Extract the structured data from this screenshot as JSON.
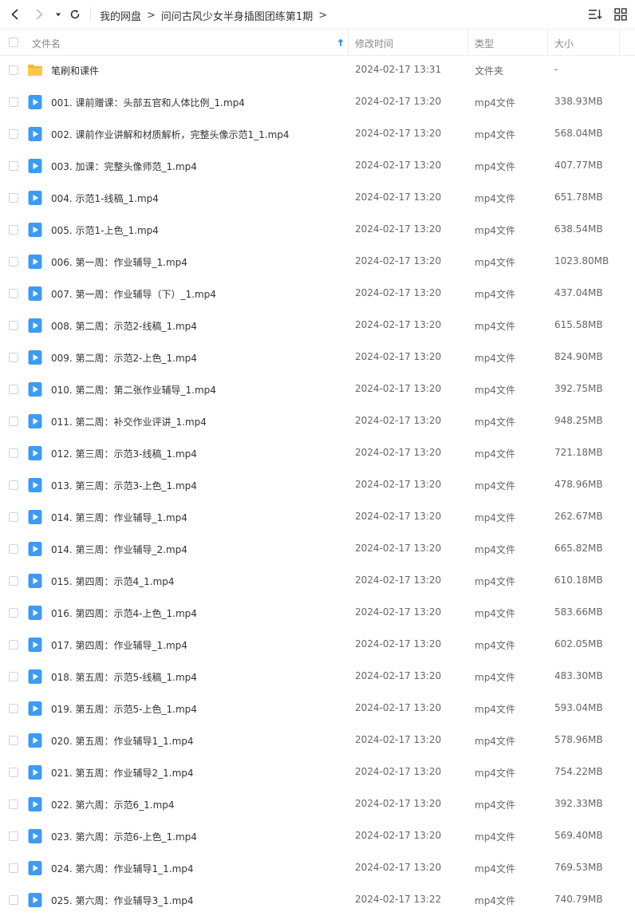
{
  "breadcrumb": [
    "我的网盘",
    "问问古风少女半身插图团练第1期"
  ],
  "columns": {
    "name": "文件名",
    "mtime": "修改时间",
    "type": "类型",
    "size": "大小"
  },
  "files": [
    {
      "icon": "folder-icon",
      "name": "笔刷和课件",
      "mtime": "2024-02-17 13:31",
      "type": "文件夹",
      "size": "-"
    },
    {
      "icon": "video-file-icon",
      "name": "001. 课前赠课：头部五官和人体比例_1.mp4",
      "mtime": "2024-02-17 13:20",
      "type": "mp4文件",
      "size": "338.93MB"
    },
    {
      "icon": "video-file-icon",
      "name": "002. 课前作业讲解和材质解析，完整头像示范1_1.mp4",
      "mtime": "2024-02-17 13:20",
      "type": "mp4文件",
      "size": "568.04MB"
    },
    {
      "icon": "video-file-icon",
      "name": "003. 加课：完整头像师范_1.mp4",
      "mtime": "2024-02-17 13:20",
      "type": "mp4文件",
      "size": "407.77MB"
    },
    {
      "icon": "video-file-icon",
      "name": "004. 示范1-线稿_1.mp4",
      "mtime": "2024-02-17 13:20",
      "type": "mp4文件",
      "size": "651.78MB"
    },
    {
      "icon": "video-file-icon",
      "name": "005. 示范1-上色_1.mp4",
      "mtime": "2024-02-17 13:20",
      "type": "mp4文件",
      "size": "638.54MB"
    },
    {
      "icon": "video-file-icon",
      "name": "006. 第一周：作业辅导_1.mp4",
      "mtime": "2024-02-17 13:20",
      "type": "mp4文件",
      "size": "1023.80MB"
    },
    {
      "icon": "video-file-icon",
      "name": "007. 第一周：作业辅导（下）_1.mp4",
      "mtime": "2024-02-17 13:20",
      "type": "mp4文件",
      "size": "437.04MB"
    },
    {
      "icon": "video-file-icon",
      "name": "008. 第二周：示范2-线稿_1.mp4",
      "mtime": "2024-02-17 13:20",
      "type": "mp4文件",
      "size": "615.58MB"
    },
    {
      "icon": "video-file-icon",
      "name": "009. 第二周：示范2-上色_1.mp4",
      "mtime": "2024-02-17 13:20",
      "type": "mp4文件",
      "size": "824.90MB"
    },
    {
      "icon": "video-file-icon",
      "name": "010. 第二周：第二张作业辅导_1.mp4",
      "mtime": "2024-02-17 13:20",
      "type": "mp4文件",
      "size": "392.75MB"
    },
    {
      "icon": "video-file-icon",
      "name": "011. 第二周：补交作业评讲_1.mp4",
      "mtime": "2024-02-17 13:20",
      "type": "mp4文件",
      "size": "948.25MB"
    },
    {
      "icon": "video-file-icon",
      "name": "012. 第三周：示范3-线稿_1.mp4",
      "mtime": "2024-02-17 13:20",
      "type": "mp4文件",
      "size": "721.18MB"
    },
    {
      "icon": "video-file-icon",
      "name": "013. 第三周：示范3-上色_1.mp4",
      "mtime": "2024-02-17 13:20",
      "type": "mp4文件",
      "size": "478.96MB"
    },
    {
      "icon": "video-file-icon",
      "name": "014. 第三周：作业辅导_1.mp4",
      "mtime": "2024-02-17 13:20",
      "type": "mp4文件",
      "size": "262.67MB"
    },
    {
      "icon": "video-file-icon",
      "name": "014. 第三周：作业辅导_2.mp4",
      "mtime": "2024-02-17 13:20",
      "type": "mp4文件",
      "size": "665.82MB"
    },
    {
      "icon": "video-file-icon",
      "name": "015. 第四周：示范4_1.mp4",
      "mtime": "2024-02-17 13:20",
      "type": "mp4文件",
      "size": "610.18MB"
    },
    {
      "icon": "video-file-icon",
      "name": "016. 第四周：示范4-上色_1.mp4",
      "mtime": "2024-02-17 13:20",
      "type": "mp4文件",
      "size": "583.66MB"
    },
    {
      "icon": "video-file-icon",
      "name": "017. 第四周：作业辅导_1.mp4",
      "mtime": "2024-02-17 13:20",
      "type": "mp4文件",
      "size": "602.05MB"
    },
    {
      "icon": "video-file-icon",
      "name": "018. 第五周：示范5-线稿_1.mp4",
      "mtime": "2024-02-17 13:20",
      "type": "mp4文件",
      "size": "483.30MB"
    },
    {
      "icon": "video-file-icon",
      "name": "019. 第五周：示范5-上色_1.mp4",
      "mtime": "2024-02-17 13:20",
      "type": "mp4文件",
      "size": "593.04MB"
    },
    {
      "icon": "video-file-icon",
      "name": "020. 第五周：作业辅导1_1.mp4",
      "mtime": "2024-02-17 13:20",
      "type": "mp4文件",
      "size": "578.96MB"
    },
    {
      "icon": "video-file-icon",
      "name": "021. 第五周：作业辅导2_1.mp4",
      "mtime": "2024-02-17 13:20",
      "type": "mp4文件",
      "size": "754.22MB"
    },
    {
      "icon": "video-file-icon",
      "name": "022. 第六周：示范6_1.mp4",
      "mtime": "2024-02-17 13:20",
      "type": "mp4文件",
      "size": "392.33MB"
    },
    {
      "icon": "video-file-icon",
      "name": "023. 第六周：示范6-上色_1.mp4",
      "mtime": "2024-02-17 13:20",
      "type": "mp4文件",
      "size": "569.40MB"
    },
    {
      "icon": "video-file-icon",
      "name": "024. 第六周：作业辅导1_1.mp4",
      "mtime": "2024-02-17 13:20",
      "type": "mp4文件",
      "size": "769.53MB"
    },
    {
      "icon": "video-file-icon",
      "name": "025. 第六周：作业辅导3_1.mp4",
      "mtime": "2024-02-17 13:22",
      "type": "mp4文件",
      "size": "740.79MB"
    }
  ]
}
